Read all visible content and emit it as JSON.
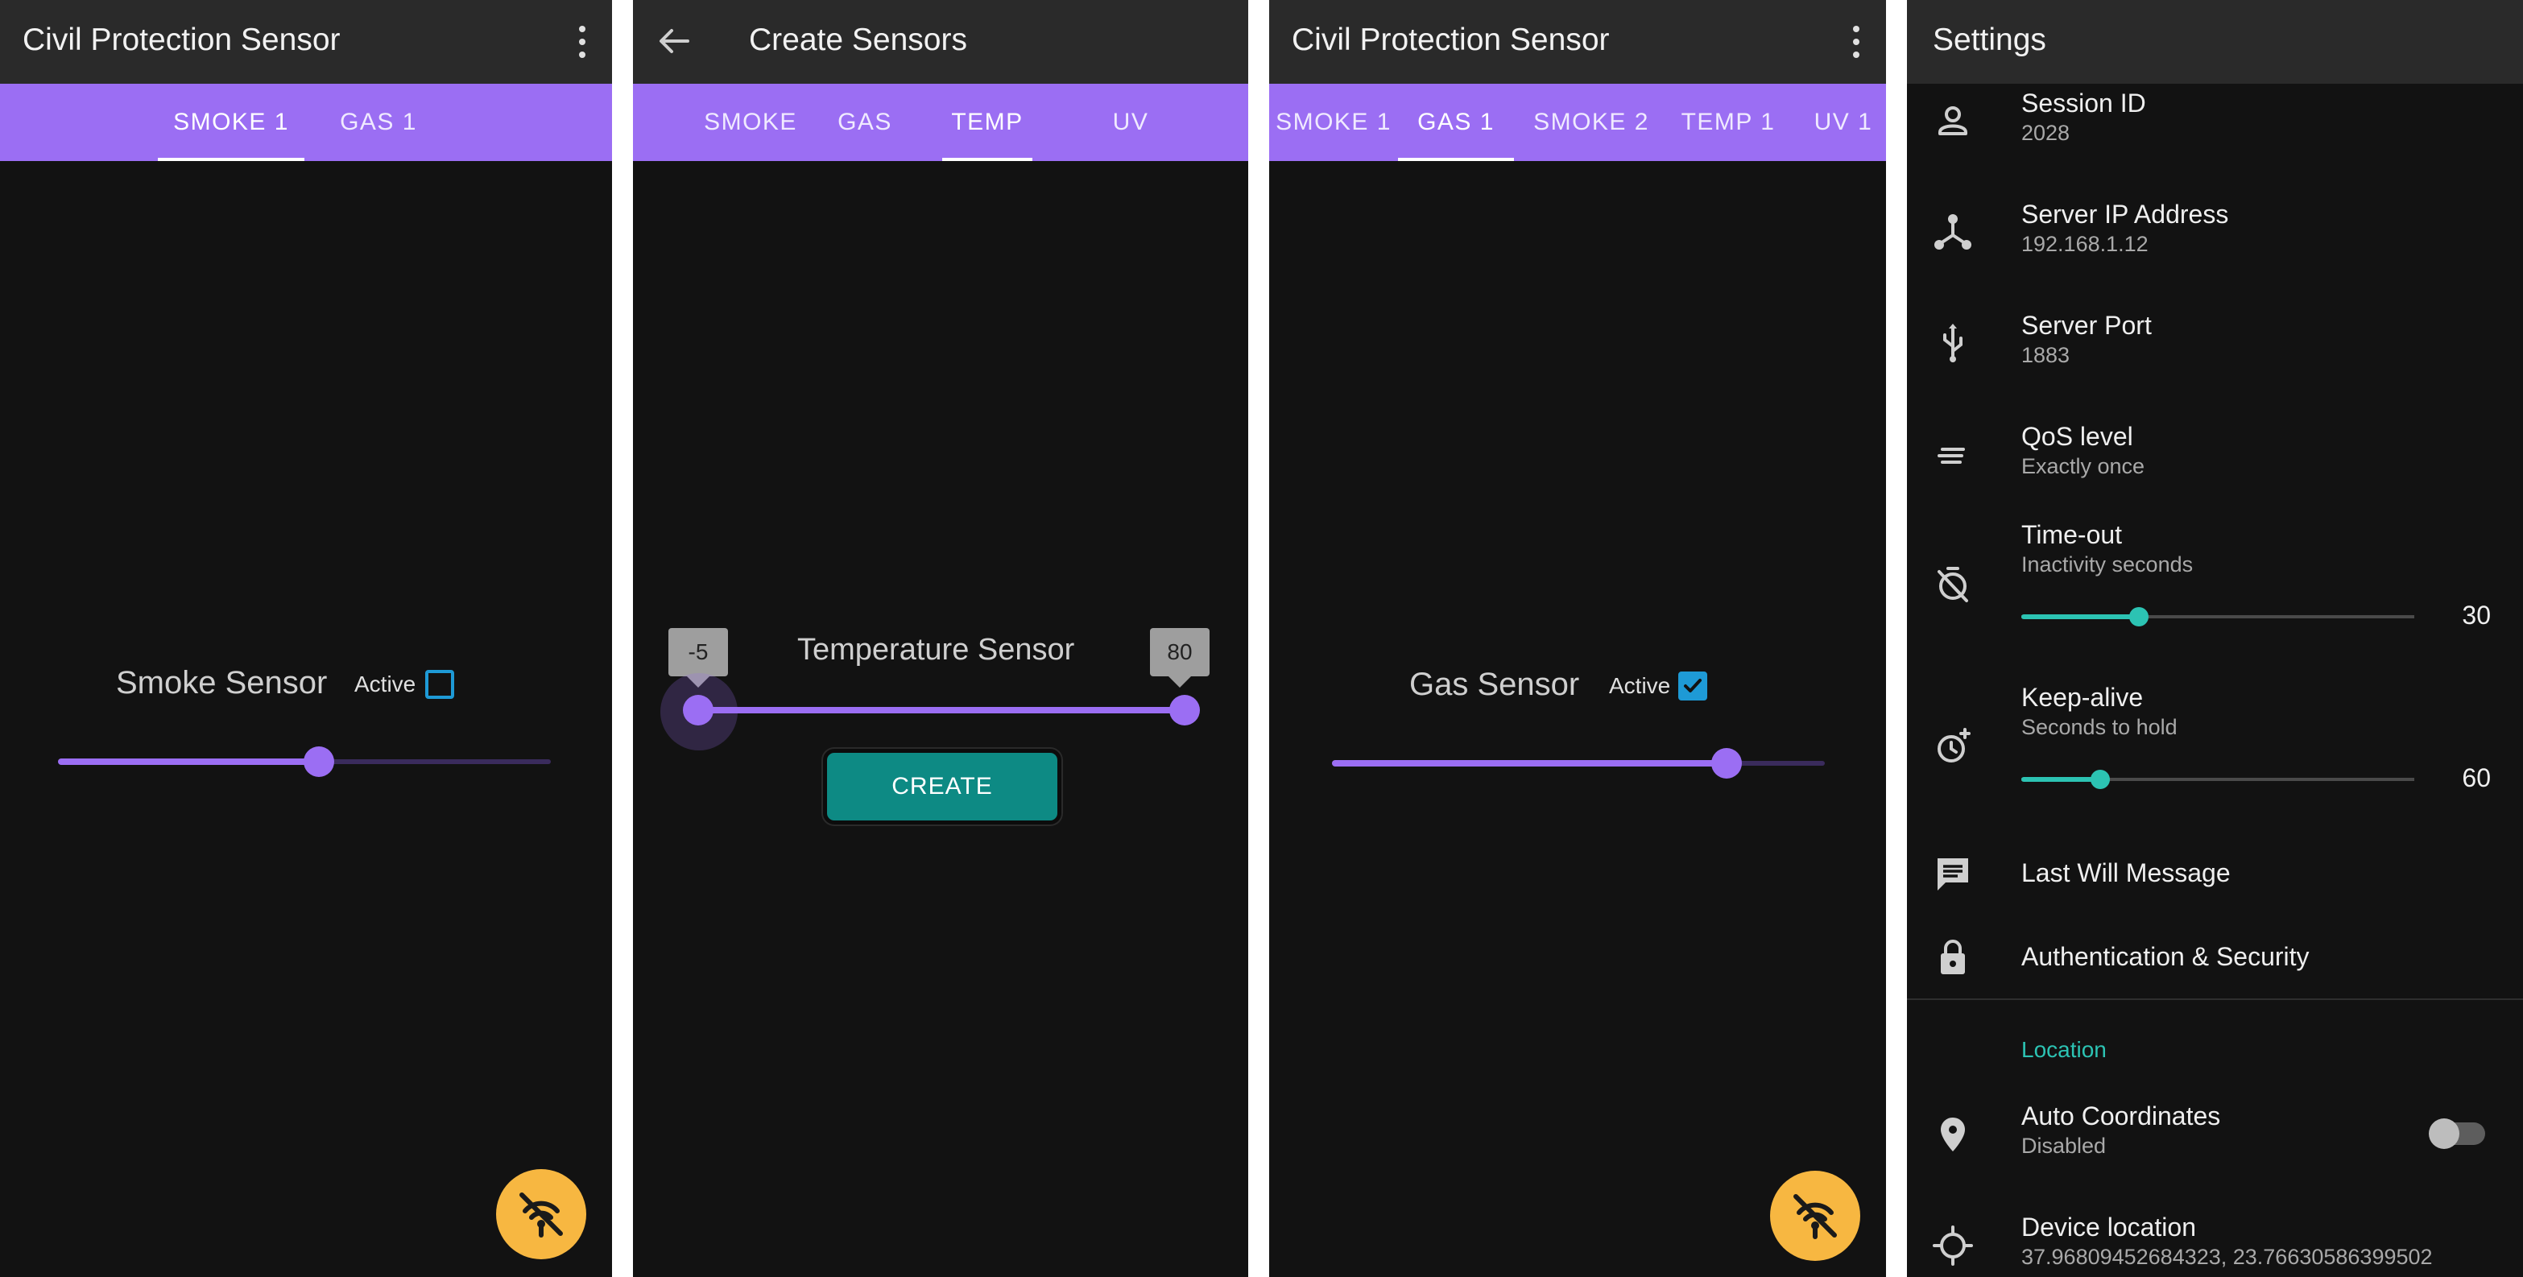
{
  "panel1": {
    "title": "Civil Protection Sensor",
    "tabs": [
      {
        "label": "SMOKE 1",
        "selected": true
      },
      {
        "label": "GAS 1",
        "selected": false
      }
    ],
    "sensor_label": "Smoke Sensor",
    "active_label": "Active",
    "active_checked": false,
    "slider_value_fraction": 0.53,
    "fab_icon": "signal-off-icon"
  },
  "panel2": {
    "title": "Create Sensors",
    "tabs": [
      {
        "label": "SMOKE",
        "selected": false
      },
      {
        "label": "GAS",
        "selected": false
      },
      {
        "label": "TEMP",
        "selected": true
      },
      {
        "label": "UV",
        "selected": false
      }
    ],
    "sensor_label": "Temperature Sensor",
    "range_min_value": "-5",
    "range_max_value": "80",
    "create_label": "CREATE"
  },
  "panel3": {
    "title": "Civil Protection Sensor",
    "tabs": [
      {
        "label": "SMOKE 1",
        "selected": false
      },
      {
        "label": "GAS 1",
        "selected": true
      },
      {
        "label": "SMOKE 2",
        "selected": false
      },
      {
        "label": "TEMP 1",
        "selected": false
      },
      {
        "label": "UV 1",
        "selected": false
      }
    ],
    "sensor_label": "Gas Sensor",
    "active_label": "Active",
    "active_checked": true,
    "slider_value_fraction": 0.8,
    "fab_icon": "signal-off-icon"
  },
  "settings": {
    "title": "Settings",
    "session_id": {
      "label": "Session ID",
      "value": "2028"
    },
    "server_ip": {
      "label": "Server IP Address",
      "value": "192.168.1.12"
    },
    "server_port": {
      "label": "Server Port",
      "value": "1883"
    },
    "qos": {
      "label": "QoS level",
      "value": "Exactly once"
    },
    "timeout": {
      "label": "Time-out",
      "sub": "Inactivity seconds",
      "value": "30"
    },
    "keepalive": {
      "label": "Keep-alive",
      "sub": "Seconds to hold",
      "value": "60"
    },
    "last_will": {
      "label": "Last Will Message"
    },
    "auth": {
      "label": "Authentication & Security"
    },
    "location_header": "Location",
    "auto_coords": {
      "label": "Auto Coordinates",
      "value": "Disabled",
      "enabled": false
    },
    "device_location": {
      "label": "Device location",
      "value": "37.96809452684323, 23.76630586399502"
    }
  },
  "colors": {
    "accent_purple": "#9b6ef3",
    "teal": "#2cc3b3",
    "fab_yellow": "#f7b741",
    "checkbox_blue": "#1e9ad6",
    "create_teal": "#0d8a84"
  }
}
